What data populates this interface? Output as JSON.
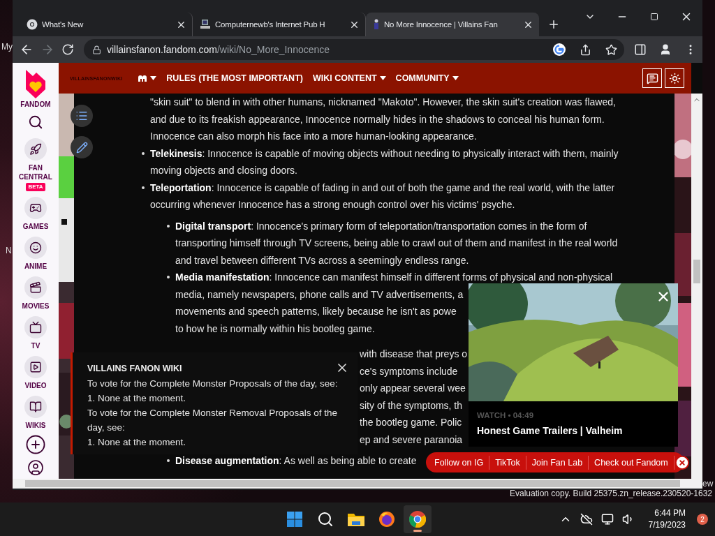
{
  "desktop": {
    "labels": [
      "My",
      "N",
      "ew"
    ],
    "watermark": "Evaluation copy. Build 25375.zn_release.230520-1632"
  },
  "browser": {
    "tabs": [
      {
        "title": "What's New",
        "kind": "chrome",
        "selected": false
      },
      {
        "title": "Computernewb's Internet Pub H",
        "kind": "computer",
        "selected": false
      },
      {
        "title": "No More Innocence | Villains Fan",
        "kind": "wiki",
        "selected": true
      }
    ],
    "url_host": "villainsfanon.fandom.com",
    "url_path": "/wiki/No_More_Innocence"
  },
  "fandom_sidebar": {
    "logo_label": "FANDOM",
    "items": [
      {
        "label": "FAN CENTRAL",
        "badge": "BETA"
      },
      {
        "label": "GAMES"
      },
      {
        "label": "ANIME"
      },
      {
        "label": "MOVIES"
      },
      {
        "label": "TV"
      },
      {
        "label": "VIDEO"
      },
      {
        "label": "WIKIS"
      }
    ]
  },
  "wiki_header": {
    "wordmark": "VILLAINSFANONWIKI",
    "nav": [
      {
        "kind": "icon",
        "dropdown": true
      },
      {
        "kind": "text",
        "label": "RULES (THE MOST IMPORTANT)",
        "dropdown": false
      },
      {
        "kind": "text",
        "label": "WIKI CONTENT",
        "dropdown": true
      },
      {
        "kind": "text",
        "label": "COMMUNITY",
        "dropdown": true
      }
    ]
  },
  "article": {
    "blocks": [
      {
        "kind": "continuation",
        "lines": [
          "\"skin suit\" to blend in with other humans, nicknamed \"Makoto\". However, the skin suit's creation was flawed,",
          "and due to its freakish appearance, Innocence normally hides in the shadows to conceal his human form.",
          "Innocence can also morph his face into a more human-looking appearance."
        ]
      },
      {
        "kind": "bullet",
        "lines": [
          "**Telekinesis**: Innocence is capable of moving objects without needing to physically interact with them, mainly",
          "moving objects and closing doors."
        ]
      },
      {
        "kind": "bullet",
        "lines": [
          "**Teleportation**: Innocence is capable of fading in and out of both the game and the real world, with the latter",
          "occurring whenever Innocence has a strong enough control over his victims' psyche."
        ]
      },
      {
        "kind": "subbullet",
        "lines": [
          "**Digital transport**: Innocence's primary form of teleportation/transportation comes in the form of",
          "transporting himself through TV screens, being able to crawl out of them and manifest in the real world",
          "and travel between different TVs across a seemingly endless range."
        ]
      },
      {
        "kind": "subbullet",
        "lines": [
          "**Media manifestation**: Innocence can manifest himself in different forms of physical and non-physical",
          "media, namely newspapers, phone calls and TV advertisements, a",
          "movements and speech patterns, likely because he isn't as powe",
          "to how he is normally within his bootleg game."
        ]
      },
      {
        "kind": "fragments",
        "lines": [
          "with disease that preys o",
          "ce's symptoms include",
          "only appear several wee",
          "sity of the symptoms, th",
          "the bootleg game. Polic",
          "ep and severe paranoia"
        ]
      },
      {
        "kind": "subbullet",
        "lines": [
          "**Disease augmentation**: As well as being able to create"
        ]
      }
    ]
  },
  "notice": {
    "title": "VILLAINS FANON WIKI",
    "paragraphs": [
      "To vote for the Complete Monster Proposals of the day, see:",
      "1. None at the moment.",
      "To vote for the Complete Monster Removal Proposals of the day, see:",
      "1. None at the moment."
    ]
  },
  "video_popup": {
    "meta": "WATCH • 04:49",
    "title": "Honest Game Trailers | Valheim"
  },
  "social_bar": {
    "links": [
      "Follow on IG",
      "TikTok",
      "Join Fan Lab",
      "Check out Fandom"
    ]
  },
  "taskbar": {
    "apps": [
      {
        "kind": "start",
        "active": false
      },
      {
        "kind": "search",
        "active": false
      },
      {
        "kind": "files",
        "active": false
      },
      {
        "kind": "firefox",
        "active": false
      },
      {
        "kind": "chrome",
        "active": true
      }
    ],
    "time": "6:44 PM",
    "date": "7/19/2023",
    "notification_count": "2"
  }
}
